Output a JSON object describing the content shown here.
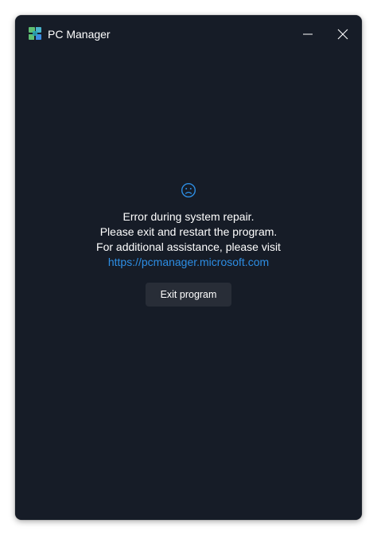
{
  "window": {
    "title": "PC Manager"
  },
  "error": {
    "icon": "sad-face-icon",
    "lines": [
      "Error during system repair.",
      "Please exit and restart the program.",
      "For additional assistance, please visit"
    ],
    "link_text": "https://pcmanager.microsoft.com",
    "button_label": "Exit program"
  },
  "colors": {
    "background": "#161c27",
    "text": "#ffffff",
    "link": "#2d8ee4",
    "button": "#282d37",
    "logo_green": "#5fbf73",
    "logo_blue": "#3c8ce0"
  }
}
